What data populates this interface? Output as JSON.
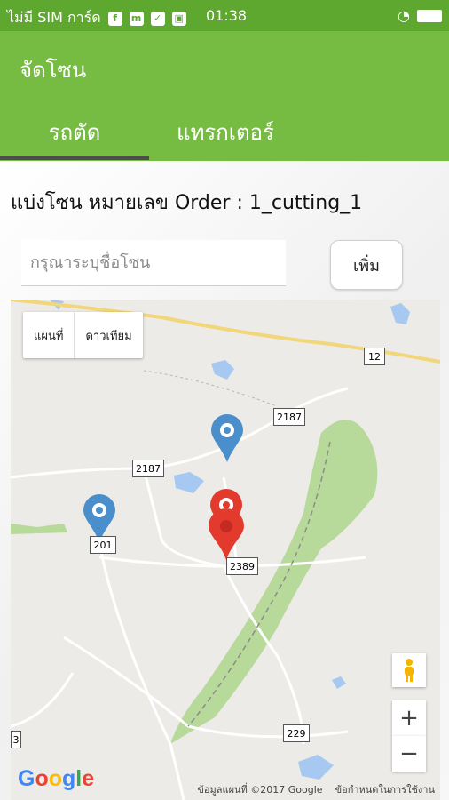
{
  "status_bar": {
    "carrier": "ไม่มี SIM การ์ด",
    "time": "01:38"
  },
  "app_bar": {
    "title": "จัดโซน"
  },
  "tabs": [
    {
      "label": "รถตัด"
    },
    {
      "label": "แทรกเตอร์"
    }
  ],
  "main": {
    "heading": "แบ่งโซน หมายเลข Order : 1_cutting_1",
    "zone_input": {
      "placeholder": "กรุณาระบุชื่อโซน",
      "value": ""
    },
    "add_button": "เพิ่ม"
  },
  "map": {
    "map_type": [
      "แผนที่",
      "ดาวเทียม"
    ],
    "road_labels": [
      "12",
      "2187",
      "2187",
      "201",
      "2389",
      "229",
      "3"
    ],
    "zoom_in": "+",
    "zoom_out": "−",
    "logo": "Google",
    "attribution": "ข้อมูลแผนที่ ©2017 Google",
    "terms": "ข้อกำหนดในการใช้งาน",
    "colors": {
      "blue_marker": "#4a8fcb",
      "red_marker": "#e23b2e",
      "forest": "#b7d99a"
    }
  }
}
